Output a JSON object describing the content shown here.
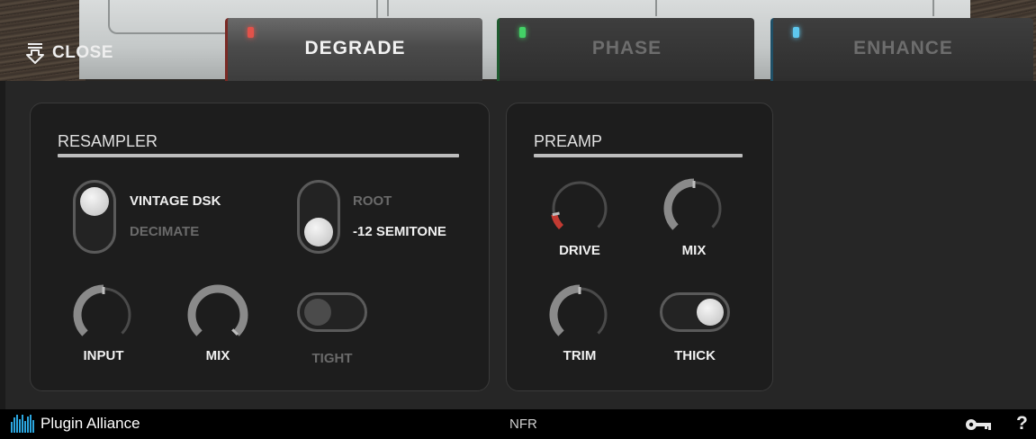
{
  "header": {
    "close_label": "CLOSE",
    "tabs": [
      {
        "label": "DEGRADE",
        "led_color": "#e2524a",
        "active": true
      },
      {
        "label": "PHASE",
        "led_color": "#43d266",
        "active": false
      },
      {
        "label": "ENHANCE",
        "led_color": "#5ec8ef",
        "active": false
      }
    ]
  },
  "resampler": {
    "title": "RESAMPLER",
    "mode_toggle": {
      "option_top": "VINTAGE DSK",
      "option_bottom": "DECIMATE",
      "selected": "VINTAGE DSK"
    },
    "pitch_toggle": {
      "option_top": "ROOT",
      "option_bottom": "-12 SEMITONE",
      "selected": "-12 SEMITONE"
    },
    "input_knob": {
      "label": "INPUT",
      "value": 0.5
    },
    "mix_knob": {
      "label": "MIX",
      "value": 1.0
    },
    "tight_toggle": {
      "label": "TIGHT",
      "on": false
    }
  },
  "preamp": {
    "title": "PREAMP",
    "drive_knob": {
      "label": "DRIVE",
      "value": 0.12,
      "accent": "#c23a32"
    },
    "mix_knob": {
      "label": "MIX",
      "value": 0.5
    },
    "trim_knob": {
      "label": "TRIM",
      "value": 0.5
    },
    "thick_toggle": {
      "label": "THICK",
      "on": true
    }
  },
  "footer": {
    "brand": "Plugin Alliance",
    "license_status": "NFR",
    "help_label": "?",
    "brand_color": "#2ba6df"
  }
}
